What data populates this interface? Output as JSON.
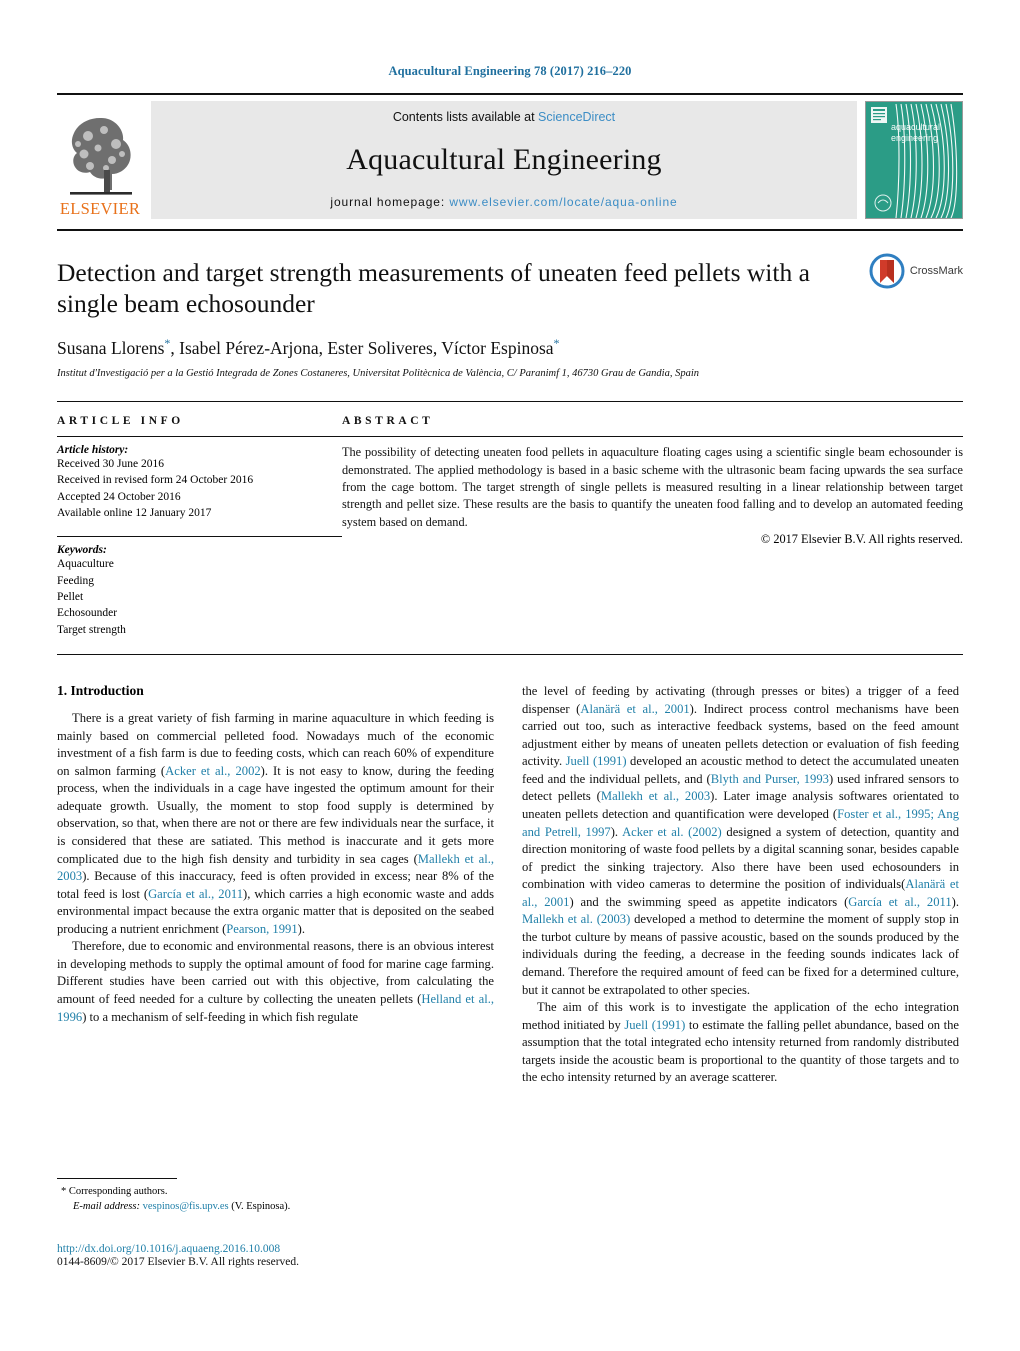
{
  "running_head": "Aquacultural Engineering 78 (2017) 216–220",
  "masthead": {
    "contents_prefix": "Contents lists available at ",
    "sciencedirect": "ScienceDirect",
    "journal_title": "Aquacultural Engineering",
    "homepage_prefix": "journal homepage: ",
    "homepage_url": "www.elsevier.com/locate/aqua-online",
    "publisher_wordmark": "ELSEVIER",
    "cover_line1": "aquacultural",
    "cover_line2": "engineering"
  },
  "article": {
    "title": "Detection and target strength measurements of uneaten feed pellets with a single beam echosounder",
    "crossmark_label": "CrossMark",
    "authors": "Susana Llorens*, Isabel Pérez-Arjona, Ester Soliveres, Víctor Espinosa*",
    "affiliation": "Institut d'Investigació per a la Gestió Integrada de Zones Costaneres, Universitat Politècnica de València, C/ Paranimf 1, 46730 Grau de Gandia, Spain"
  },
  "article_info": {
    "heading": "ARTICLE INFO",
    "history_label": "Article history:",
    "history": [
      "Received 30 June 2016",
      "Received in revised form 24 October 2016",
      "Accepted 24 October 2016",
      "Available online 12 January 2017"
    ],
    "keywords_label": "Keywords:",
    "keywords": [
      "Aquaculture",
      "Feeding",
      "Pellet",
      "Echosounder",
      "Target strength"
    ]
  },
  "abstract": {
    "heading": "ABSTRACT",
    "text": "The possibility of detecting uneaten food pellets in aquaculture floating cages using a scientific single beam echosounder is demonstrated. The applied methodology is based in a basic scheme with the ultrasonic beam facing upwards the sea surface from the cage bottom. The target strength of single pellets is measured resulting in a linear relationship between target strength and pellet size. These results are the basis to quantify the uneaten food falling and to develop an automated feeding system based on demand.",
    "copyright": "© 2017 Elsevier B.V. All rights reserved."
  },
  "body": {
    "section_number_title": "1.  Introduction",
    "left_paragraphs": [
      {
        "segments": [
          {
            "t": "There is a great variety of fish farming in marine aquaculture in which feeding is mainly based on commercial pelleted food. Nowadays much of the economic investment of a fish farm is due to feeding costs, which can reach 60% of expenditure on salmon farming (",
            "cite": false
          },
          {
            "t": "Acker et al., 2002",
            "cite": true
          },
          {
            "t": "). It is not easy to know, during the feeding process, when the individuals in a cage have ingested the optimum amount for their adequate growth. Usually, the moment to stop food supply is determined by observation, so that, when there are not or there are few individuals near the surface, it is considered that these are satiated. This method is inaccurate and it gets more complicated due to the high fish density and turbidity in sea cages (",
            "cite": false
          },
          {
            "t": "Mallekh et al., 2003",
            "cite": true
          },
          {
            "t": "). Because of this inaccuracy, feed is often provided in excess; near 8% of the total feed is lost (",
            "cite": false
          },
          {
            "t": "García et al., 2011",
            "cite": true
          },
          {
            "t": "), which carries a high economic waste and adds environmental impact because the extra organic matter that is deposited on the seabed producing a nutrient enrichment (",
            "cite": false
          },
          {
            "t": "Pearson, 1991",
            "cite": true
          },
          {
            "t": ").",
            "cite": false
          }
        ]
      },
      {
        "segments": [
          {
            "t": "Therefore, due to economic and environmental reasons, there is an obvious interest in developing methods to supply the optimal amount of food for marine cage farming. Different studies have been carried out with this objective, from calculating the amount of feed needed for a culture by collecting the uneaten pellets (",
            "cite": false
          },
          {
            "t": "Helland et al., 1996",
            "cite": true
          },
          {
            "t": ") to a mechanism of self-feeding in which fish regulate",
            "cite": false
          }
        ]
      }
    ],
    "right_paragraphs": [
      {
        "segments": [
          {
            "t": "the level of feeding by activating (through presses or bites) a trigger of a feed dispenser (",
            "cite": false
          },
          {
            "t": "Alanärä et al., 2001",
            "cite": true
          },
          {
            "t": "). Indirect process control mechanisms have been carried out too, such as interactive feedback systems, based on the feed amount adjustment either by means of uneaten pellets detection or evaluation of fish feeding activity. ",
            "cite": false
          },
          {
            "t": "Juell (1991)",
            "cite": true
          },
          {
            "t": " developed an acoustic method to detect the accumulated uneaten feed and the individual pellets, and (",
            "cite": false
          },
          {
            "t": "Blyth and Purser, 1993",
            "cite": true
          },
          {
            "t": ") used infrared sensors to detect pellets (",
            "cite": false
          },
          {
            "t": "Mallekh et al., 2003",
            "cite": true
          },
          {
            "t": "). Later image analysis softwares orientated to uneaten pellets detection and quantification were developed (",
            "cite": false
          },
          {
            "t": "Foster et al., 1995; Ang and Petrell, 1997",
            "cite": true
          },
          {
            "t": "). ",
            "cite": false
          },
          {
            "t": "Acker et al. (2002)",
            "cite": true
          },
          {
            "t": " designed a system of detection, quantity and direction monitoring of waste food pellets by a digital scanning sonar, besides capable of predict the sinking trajectory. Also there have been used echosounders in combination with video cameras to determine the position of individuals(",
            "cite": false
          },
          {
            "t": "Alanärä et al., 2001",
            "cite": true
          },
          {
            "t": ") and the swimming speed as appetite indicators (",
            "cite": false
          },
          {
            "t": "García et al., 2011",
            "cite": true
          },
          {
            "t": "). ",
            "cite": false
          },
          {
            "t": "Mallekh et al. (2003)",
            "cite": true
          },
          {
            "t": " developed a method to determine the moment of supply stop in the turbot culture by means of passive acoustic, based on the sounds produced by the individuals during the feeding, a decrease in the feeding sounds indicates lack of demand. Therefore the required amount of feed can be fixed for a determined culture, but it cannot be extrapolated to other species.",
            "cite": false
          }
        ]
      },
      {
        "segments": [
          {
            "t": "The aim of this work is to investigate the application of the echo integration method initiated by ",
            "cite": false
          },
          {
            "t": "Juell (1991)",
            "cite": true
          },
          {
            "t": " to estimate the falling pellet abundance, based on the assumption that the total integrated echo intensity returned from randomly distributed targets inside the acoustic beam is proportional to the quantity of those targets and to the echo intensity returned by an average scatterer.",
            "cite": false
          }
        ]
      }
    ]
  },
  "footer": {
    "corresponding_marker": "*",
    "corresponding_text": "Corresponding authors.",
    "email_label": "E-mail address:",
    "email": "vespinos@fis.upv.es",
    "email_owner": "(V. Espinosa).",
    "doi": "http://dx.doi.org/10.1016/j.aquaeng.2016.10.008",
    "issn_copyright": "0144-8609/© 2017 Elsevier B.V. All rights reserved."
  },
  "colors": {
    "link": "#1f7fa8",
    "sciencedirect": "#3c8dc5",
    "elsevier_orange": "#e8711a",
    "cover_teal": "#2b9c86",
    "running_head": "#1f6f9e"
  }
}
